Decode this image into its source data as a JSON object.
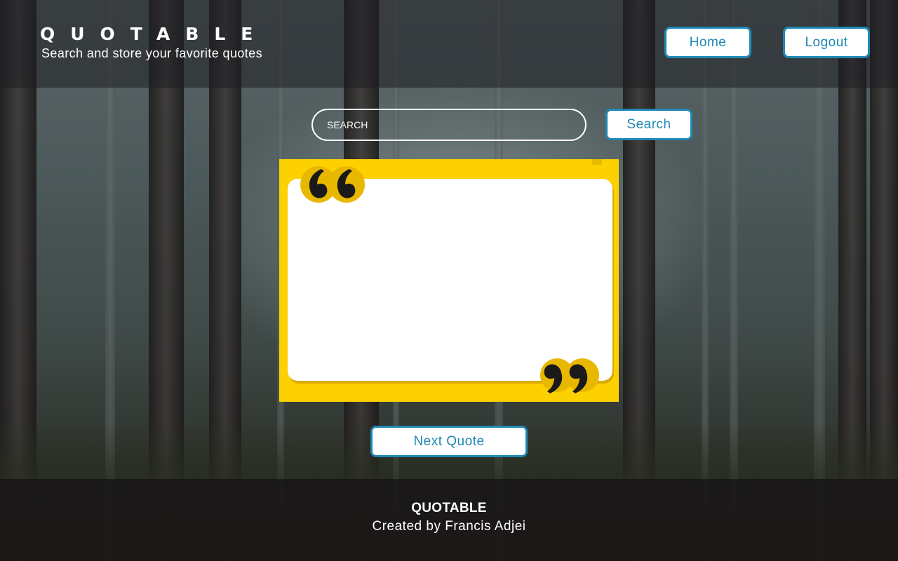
{
  "header": {
    "title": "QUOTABLE",
    "tagline": "Search and store your favorite quotes",
    "nav": {
      "home_label": "Home",
      "logout_label": "Logout"
    }
  },
  "search": {
    "placeholder": "SEARCH",
    "value": "",
    "button_label": "Search"
  },
  "quote": {
    "text": ""
  },
  "actions": {
    "next_quote_label": "Next Quote"
  },
  "footer": {
    "brand": "QUOTABLE",
    "credit": "Created by Francis Adjei"
  },
  "colors": {
    "accent": "#1f88b4",
    "quote_card": "#fdd000",
    "button_bg": "#ffffff"
  }
}
